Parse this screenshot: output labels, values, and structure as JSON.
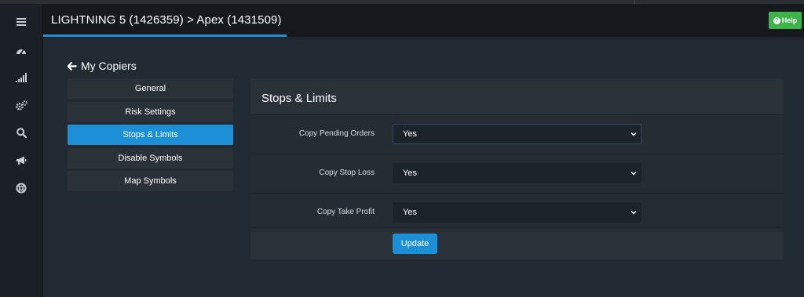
{
  "header": {
    "title": "LIGHTNING 5 (1426359) > Apex (1431509)",
    "help_label": "Help",
    "help_color": "#3bb449",
    "accent_color": "#1c8fd6"
  },
  "sidebar": {
    "icons": [
      "menu-icon",
      "dashboard-icon",
      "signal-bars-icon",
      "gears-icon",
      "search-icon",
      "megaphone-icon",
      "lifebuoy-icon"
    ]
  },
  "back_link": {
    "label": "My Copiers"
  },
  "nav": {
    "items": [
      {
        "label": "General",
        "active": false
      },
      {
        "label": "Risk Settings",
        "active": false
      },
      {
        "label": "Stops & Limits",
        "active": true
      },
      {
        "label": "Disable Symbols",
        "active": false
      },
      {
        "label": "Map Symbols",
        "active": false
      }
    ]
  },
  "panel": {
    "title": "Stops & Limits",
    "fields": [
      {
        "label": "Copy Pending Orders",
        "value": "Yes"
      },
      {
        "label": "Copy Stop Loss",
        "value": "Yes"
      },
      {
        "label": "Copy Take Profit",
        "value": "Yes"
      }
    ],
    "update_label": "Update"
  }
}
